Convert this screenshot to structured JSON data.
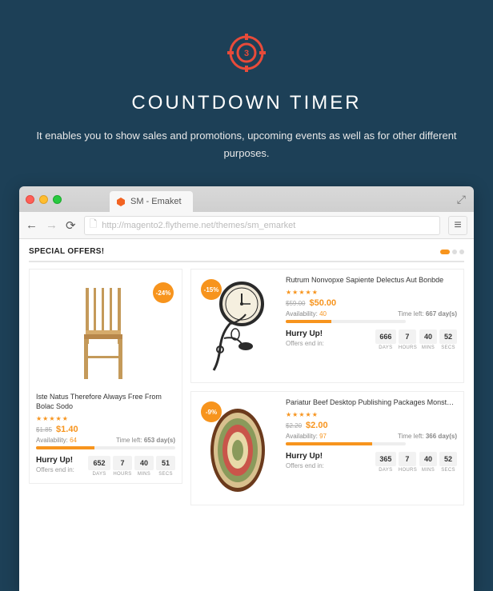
{
  "hero": {
    "title": "COUNTDOWN TIMER",
    "subtitle": "It enables you to show sales and promotions, upcoming events as well as for other different purposes.",
    "badge_number": "3"
  },
  "browser": {
    "tab_title": "SM - Emaket",
    "url": "http://magento2.flytheme.net/themes/sm_emarket"
  },
  "section": {
    "title": "SPECIAL OFFERS!"
  },
  "labels": {
    "availability": "Availability:",
    "time_left_prefix": "Time left:",
    "hurry": "Hurry Up!",
    "offers_end": "Offers end in:",
    "cd_days": "DAYS",
    "cd_hours": "HOURS",
    "cd_mins": "MINS",
    "cd_secs": "SECS"
  },
  "products": {
    "left": {
      "title": "Iste Natus Therefore Always Free From Bolac Sodo",
      "discount": "-24%",
      "old_price": "$1.85",
      "price": "$1.40",
      "availability": "64",
      "time_left": "653 day(s)",
      "avail_pct": 42,
      "countdown": {
        "days": "652",
        "hours": "7",
        "mins": "40",
        "secs": "51"
      }
    },
    "right_top": {
      "title": "Rutrum Nonvopxe Sapiente Delectus Aut Bonbde",
      "discount": "-15%",
      "old_price": "$59.00",
      "price": "$50.00",
      "availability": "40",
      "time_left": "667 day(s)",
      "avail_pct": 38,
      "countdown": {
        "days": "666",
        "hours": "7",
        "mins": "40",
        "secs": "52"
      }
    },
    "right_bottom": {
      "title": "Pariatur Beef Desktop Publishing Packages Monst…",
      "discount": "-9%",
      "old_price": "$2.20",
      "price": "$2.00",
      "availability": "97",
      "time_left": "366 day(s)",
      "avail_pct": 72,
      "countdown": {
        "days": "365",
        "hours": "7",
        "mins": "40",
        "secs": "52"
      }
    }
  }
}
